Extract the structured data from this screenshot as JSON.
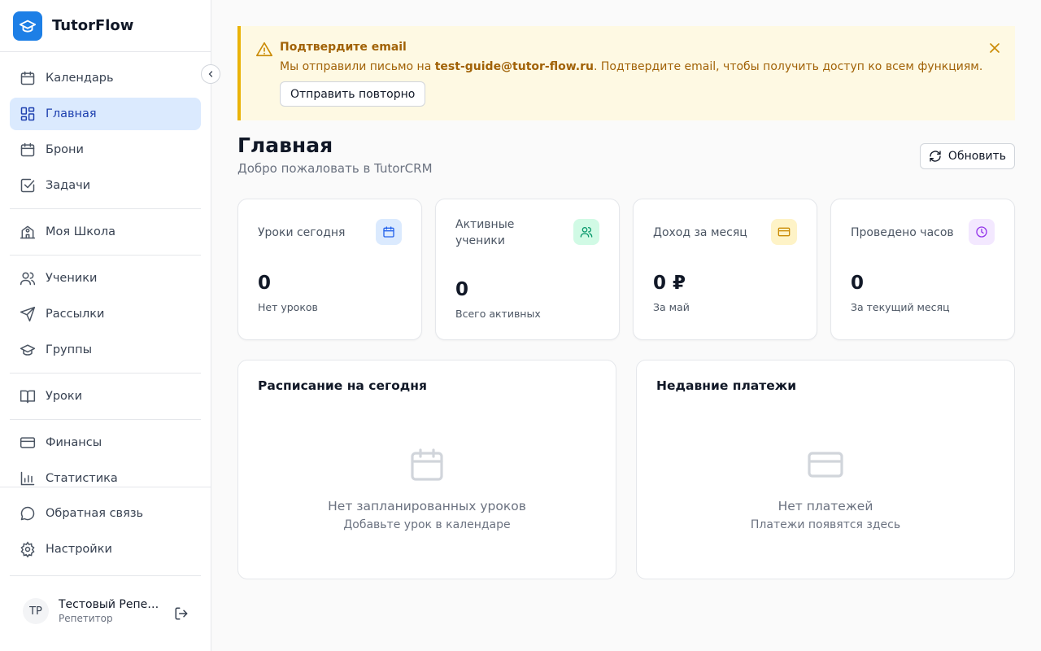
{
  "brand": {
    "name": "TutorFlow",
    "logo_icon": "graduation-cap-icon",
    "color": "#1d7fe6"
  },
  "sidebar": {
    "items": [
      {
        "label": "Календарь",
        "icon": "calendar-icon"
      },
      {
        "label": "Главная",
        "icon": "dashboard-icon",
        "active": true
      },
      {
        "label": "Брони",
        "icon": "calendar-icon"
      },
      {
        "label": "Задачи",
        "icon": "checkbox-icon"
      },
      {
        "label": "Моя Школа",
        "icon": "school-icon"
      },
      {
        "label": "Ученики",
        "icon": "users-icon"
      },
      {
        "label": "Рассылки",
        "icon": "send-icon"
      },
      {
        "label": "Группы",
        "icon": "graduation-cap-icon"
      },
      {
        "label": "Уроки",
        "icon": "book-icon"
      },
      {
        "label": "Финансы",
        "icon": "credit-card-icon"
      },
      {
        "label": "Статистика",
        "icon": "bar-chart-icon"
      },
      {
        "label": "Обратная связь",
        "icon": "message-icon"
      },
      {
        "label": "Настройки",
        "icon": "gear-icon"
      }
    ]
  },
  "user": {
    "initials": "TP",
    "name": "Тестовый Репетитор",
    "role": "Репетитор"
  },
  "banner": {
    "title": "Подтвердите email",
    "text_before": "Мы отправили письмо на ",
    "email": "test-guide@tutor-flow.ru",
    "text_after": ". Подтвердите email, чтобы получить доступ ко всем функциям.",
    "button": "Отправить повторно",
    "color": "#a16207"
  },
  "header": {
    "title": "Главная",
    "subtitle": "Добро пожаловать в TutorCRM",
    "refresh": "Обновить"
  },
  "stats": [
    {
      "label": "Уроки сегодня",
      "value": "0",
      "caption": "Нет уроков",
      "icon": "calendar-icon",
      "color": "#2563eb"
    },
    {
      "label": "Активные ученики",
      "value": "0",
      "caption": "Всего активных",
      "icon": "users-icon",
      "color": "#059669"
    },
    {
      "label": "Доход за месяц",
      "value": "0 ₽",
      "caption": "За май",
      "icon": "credit-card-icon",
      "color": "#ca8a04"
    },
    {
      "label": "Проведено часов",
      "value": "0",
      "caption": "За текущий месяц",
      "icon": "clock-icon",
      "color": "#9333ea"
    }
  ],
  "panels": {
    "schedule": {
      "title": "Расписание на сегодня",
      "empty_title": "Нет запланированных уроков",
      "empty_sub": "Добавьте урок в календаре"
    },
    "payments": {
      "title": "Недавние платежи",
      "empty_title": "Нет платежей",
      "empty_sub": "Платежи появятся здесь"
    }
  }
}
